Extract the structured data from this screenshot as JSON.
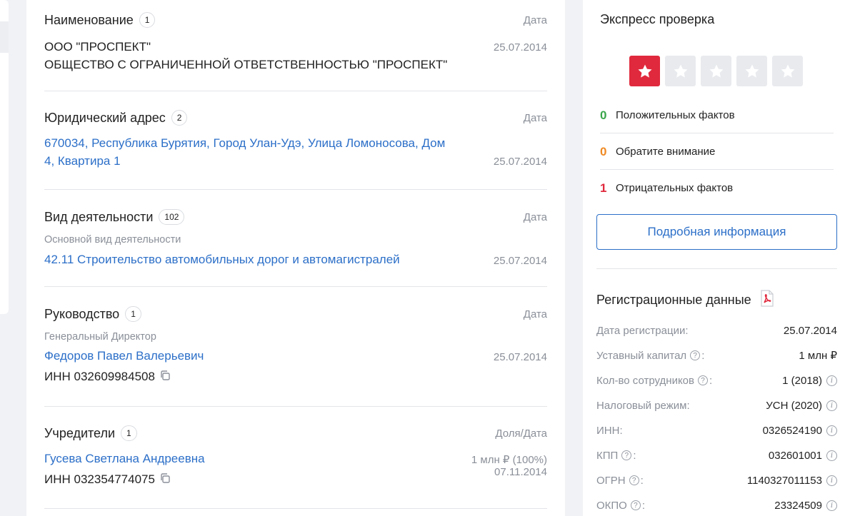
{
  "sections": {
    "name": {
      "title": "Наименование",
      "badge": "1",
      "col_head": "Дата",
      "short_name": "ООО \"ПРОСПЕКТ\"",
      "full_name": "ОБЩЕСТВО С ОГРАНИЧЕННОЙ ОТВЕТСТВЕННОСТЬЮ \"ПРОСПЕКТ\"",
      "date": "25.07.2014"
    },
    "address": {
      "title": "Юридический адрес",
      "badge": "2",
      "col_head": "Дата",
      "line1": "670034, Республика Бурятия, Город Улан-Удэ, Улица Ломоносова, Дом",
      "line2": "4, Квартира 1",
      "date": "25.07.2014"
    },
    "activity": {
      "title": "Вид деятельности",
      "badge": "102",
      "col_head": "Дата",
      "sub_label": "Основной вид деятельности",
      "value": "42.11 Строительство автомобильных дорог и автомагистралей",
      "date": "25.07.2014"
    },
    "management": {
      "title": "Руководство",
      "badge": "1",
      "col_head": "Дата",
      "role": "Генеральный Директор",
      "person": "Федоров Павел Валерьевич",
      "inn": "ИНН 032609984508",
      "date": "25.07.2014"
    },
    "founders": {
      "title": "Учредители",
      "badge": "1",
      "col_head": "Доля/Дата",
      "person": "Гусева Светлана Андреевна",
      "inn": "ИНН 032354774075",
      "share": "1 млн ₽ (100%)",
      "date": "07.11.2014"
    }
  },
  "express": {
    "title": "Экспресс проверка",
    "rating": 1,
    "rating_max": 5,
    "facts": [
      {
        "count": "0",
        "label": "Положительных фактов",
        "color": "#3aa54a"
      },
      {
        "count": "0",
        "label": "Обратите внимание",
        "color": "#f08a24"
      },
      {
        "count": "1",
        "label": "Отрицательных фактов",
        "color": "#e0293d"
      }
    ],
    "more_button": "Подробная информация"
  },
  "registration": {
    "title": "Регистрационные данные",
    "rows": [
      {
        "label": "Дата регистрации:",
        "value": "25.07.2014",
        "help": false,
        "info": false
      },
      {
        "label": "Уставный капитал",
        "value": "1 млн ₽",
        "help": true,
        "info": false
      },
      {
        "label": "Кол-во сотрудников",
        "value": "1 (2018)",
        "help": true,
        "info": true
      },
      {
        "label": "Налоговый режим:",
        "value": "УСН (2020)",
        "help": false,
        "info": true
      },
      {
        "label": "ИНН:",
        "value": "0326524190",
        "help": false,
        "info": true
      },
      {
        "label": "КПП",
        "value": "032601001",
        "help": true,
        "info": true
      },
      {
        "label": "ОГРН",
        "value": "1140327011153",
        "help": true,
        "info": true
      },
      {
        "label": "ОКПО",
        "value": "23324509",
        "help": true,
        "info": true
      }
    ]
  },
  "colors": {
    "link": "#2c6fc8",
    "accent_red": "#e0293d",
    "muted": "#8a8f98"
  }
}
